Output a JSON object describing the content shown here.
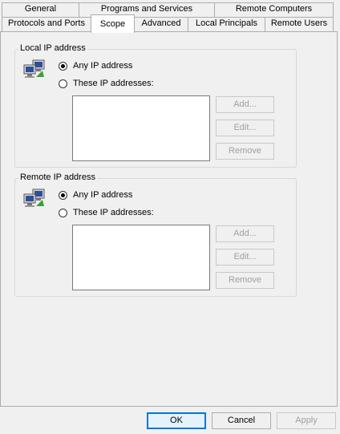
{
  "tabs_row1": [
    {
      "label": "General"
    },
    {
      "label": "Programs and Services"
    },
    {
      "label": "Remote Computers"
    }
  ],
  "tabs_row2": [
    {
      "label": "Protocols and Ports"
    },
    {
      "label": "Scope"
    },
    {
      "label": "Advanced"
    },
    {
      "label": "Local Principals"
    },
    {
      "label": "Remote Users"
    }
  ],
  "selected_tab": "Scope",
  "local": {
    "title": "Local IP address",
    "any_label": "Any IP address",
    "these_label": "These IP addresses:",
    "selected": "any",
    "add": "Add...",
    "edit": "Edit...",
    "remove": "Remove"
  },
  "remote": {
    "title": "Remote IP address",
    "any_label": "Any IP address",
    "these_label": "These IP addresses:",
    "selected": "any",
    "add": "Add...",
    "edit": "Edit...",
    "remove": "Remove"
  },
  "footer": {
    "ok": "OK",
    "cancel": "Cancel",
    "apply": "Apply"
  },
  "icons": {
    "scope": "network-computers-icon"
  }
}
